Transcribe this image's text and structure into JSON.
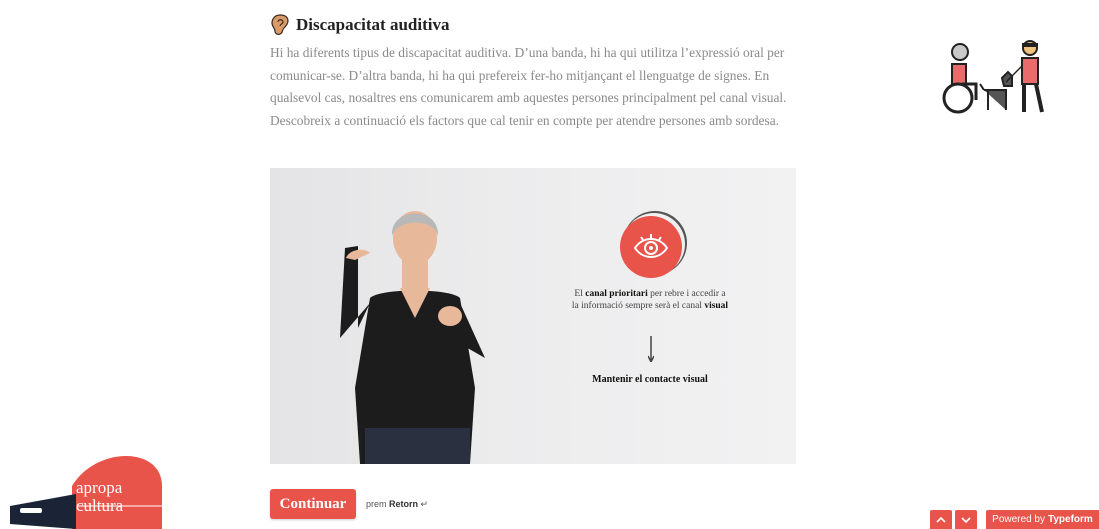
{
  "question": {
    "title": "Discapacitat auditiva",
    "title_icon": "ear-icon",
    "description": "Hi ha diferents tipus de discapacitat auditiva. D’una banda, hi ha qui utilitza l’expressió oral per comunicar-se. D’altra banda, hi ha qui prefereix fer-ho mitjançant el llenguatge de signes. En qualsevol cas, nosaltres ens comunicarem amb aquestes persones principalment pel canal visual. Descobreix a continuació els factors que cal tenir en compte per atendre persones amb sordesa."
  },
  "illustration": {
    "icon": "accessibility-people-icon"
  },
  "video": {
    "circle_icon": "eye-icon",
    "text_1": "El ",
    "text_bold_1": "canal prioritari",
    "text_2": " per rebre i accedir a la informació sempre serà el canal ",
    "text_bold_2": "visual",
    "bottom_text": "Mantenir el contacte visual"
  },
  "actions": {
    "continue_label": "Continuar",
    "hint_prefix": "prem ",
    "hint_key": "Retorn",
    "hint_icon": "↵"
  },
  "logo": {
    "line1": "apropa",
    "line2": "cultura"
  },
  "footer": {
    "up_icon": "chevron-up-icon",
    "down_icon": "chevron-down-icon",
    "powered_prefix": "Powered by",
    "powered_brand": "Typeform"
  },
  "colors": {
    "accent": "#e8534a"
  }
}
